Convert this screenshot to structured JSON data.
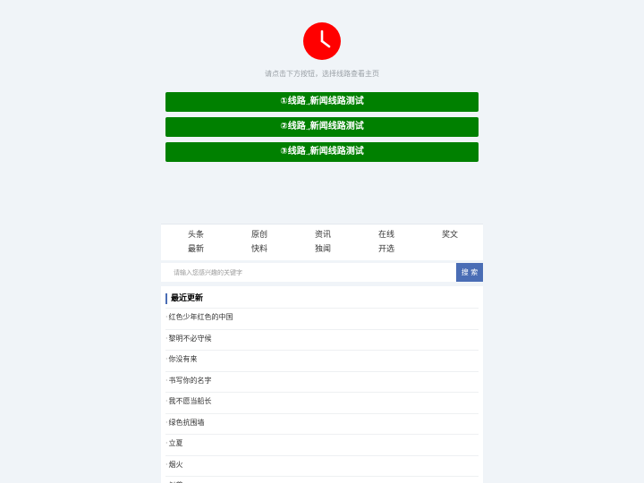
{
  "colors": {
    "clock_red": "#ff0000",
    "route_green": "#008000",
    "search_blue": "#4a6db5",
    "page_bg": "#f0f4f8"
  },
  "header": {
    "icon": "clock-icon",
    "hint": "请点击下方按钮，选择线路查看主页"
  },
  "routes": [
    {
      "num": "①",
      "label": "线路",
      "arrow": "→",
      "name": "新闻线路测试"
    },
    {
      "num": "②",
      "label": "线路",
      "arrow": "→",
      "name": "新闻线路测试"
    },
    {
      "num": "③",
      "label": "线路",
      "arrow": "→",
      "name": "新闻线路测试"
    }
  ],
  "nav": {
    "row1": [
      "头条",
      "原创",
      "资讯",
      "在线",
      "奖文"
    ],
    "row2": [
      "最新",
      "快料",
      "独闻",
      "开选"
    ]
  },
  "search": {
    "placeholder": "请输入您感兴趣的关键字",
    "button_label": "搜 索"
  },
  "updates": {
    "title": "最近更新",
    "items": [
      "红色少年红色的中国",
      "黎明不必守候",
      "你没有来",
      "书写你的名字",
      "我不愿当船长",
      "绿色抗围墙",
      "立夏",
      "烟火",
      "似曾"
    ]
  }
}
